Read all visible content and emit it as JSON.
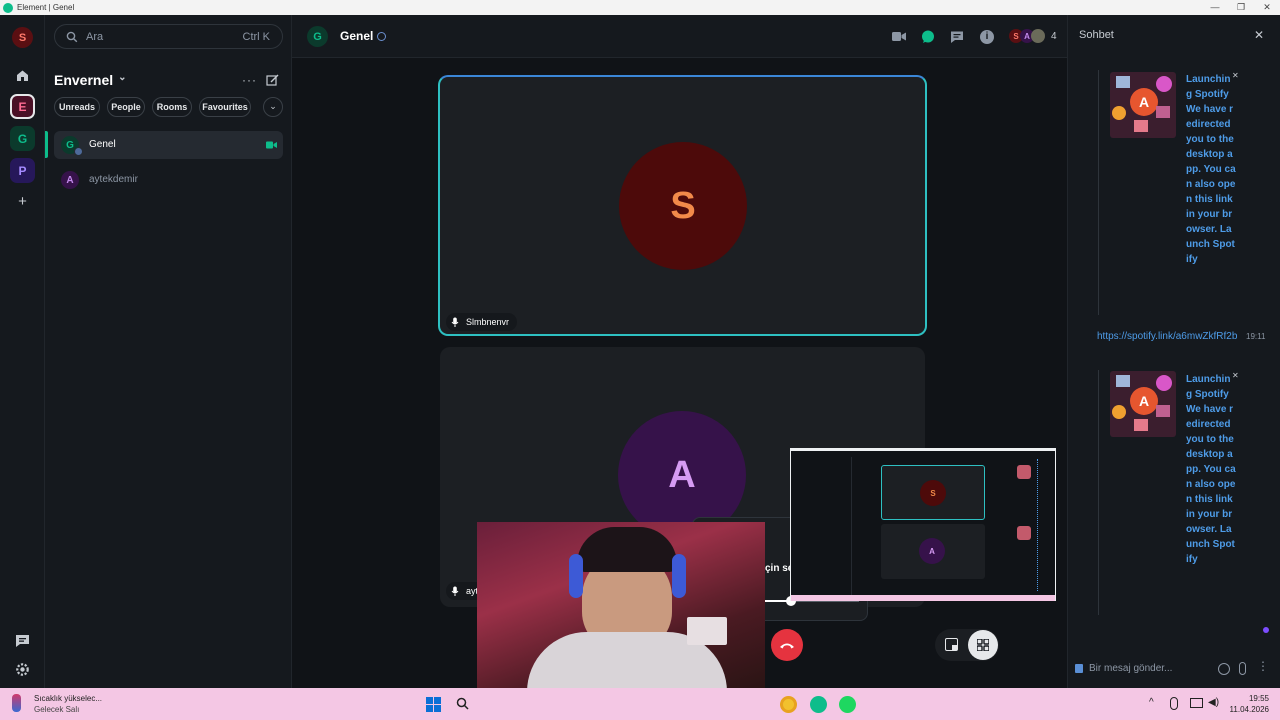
{
  "window": {
    "title": "Element | Genel",
    "minimize": "—",
    "maximize": "❐",
    "close": "✕"
  },
  "rail": {
    "user_initial": "S",
    "spaces": [
      {
        "letter": "E",
        "color": "#d2245c"
      },
      {
        "letter": "G",
        "color": "#0dbd8b"
      },
      {
        "letter": "P",
        "color": "#7c4dff"
      }
    ],
    "add": "+"
  },
  "search": {
    "placeholder": "Ara",
    "shortcut": "Ctrl K"
  },
  "space": {
    "name": "Envernel",
    "chevron": "⌄"
  },
  "filters": [
    "Unreads",
    "People",
    "Rooms",
    "Favourites"
  ],
  "rooms": [
    {
      "initial": "G",
      "name": "Genel"
    },
    {
      "initial": "A",
      "name": "aytekdemir"
    }
  ],
  "room": {
    "initial": "G",
    "name": "Genel",
    "member_avatars": [
      "S",
      "A"
    ],
    "member_count": "4"
  },
  "call": {
    "participants": [
      {
        "initial": "S",
        "name": "Slmbnenvr"
      },
      {
        "initial": "A",
        "name": "ayt"
      }
    ],
    "settings_toggle_label": "çin sessize al"
  },
  "thread": {
    "title": "Sohbet",
    "card_text": "Launching Spotify We have redirected you to the desktop app. You can also open this link in your browser. Launch Spotify",
    "card_initial": "A",
    "link": "https://spotify.link/a6mwZkfRf2b",
    "link_time": "19:11",
    "composer_placeholder": "Bir mesaj gönder..."
  },
  "taskbar": {
    "weather_title": "Sıcaklık yükselec...",
    "weather_sub": "Gelecek Salı",
    "time": "19:55",
    "date": "11.04.2026"
  },
  "colors": {
    "accent": "#0dbd8b",
    "link": "#4e9ce8",
    "hangup": "#e5333f",
    "active_border": "#2ec0c2"
  }
}
